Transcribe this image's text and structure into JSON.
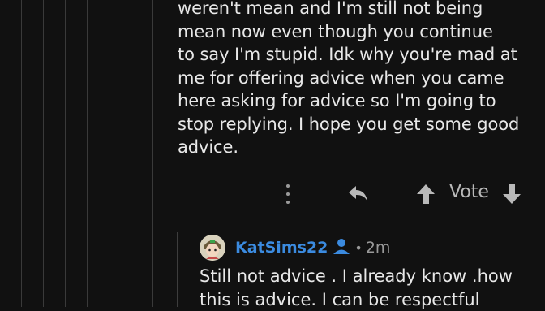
{
  "comment": {
    "lines": [
      "weren't mean and I'm still not being",
      "mean now even though you continue",
      "to say I'm stupid. Idk why you're mad at",
      "me for offering advice when you came",
      "here asking for advice so I'm going to",
      "stop replying. I hope you get some good",
      "advice."
    ],
    "actions": {
      "more_icon": "more-vertical-icon",
      "reply_icon": "reply-arrow-icon",
      "upvote_icon": "arrow-up-icon",
      "vote_label": "Vote",
      "downvote_icon": "arrow-down-icon"
    }
  },
  "reply": {
    "username": "KatSims22",
    "badge_icon": "user-icon",
    "separator": "•",
    "timestamp": "2m",
    "lines": [
      "Still not advice . I already know .how",
      "this is advice.  I can be respectful"
    ]
  },
  "colors": {
    "background": "#111111",
    "username": "#3b8be0",
    "text": "#e8e8e8",
    "muted": "#b9b9b9"
  }
}
